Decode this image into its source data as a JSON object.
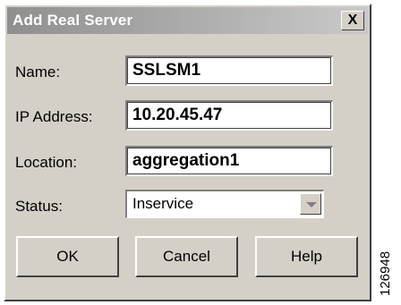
{
  "dialog": {
    "title": "Add Real Server",
    "close_symbol": "X"
  },
  "form": {
    "name_label": "Name:",
    "name_value": "SSLSM1",
    "ip_label": "IP Address:",
    "ip_value": "10.20.45.47",
    "location_label": "Location:",
    "location_value": "aggregation1",
    "status_label": "Status:",
    "status_value": "Inservice"
  },
  "buttons": {
    "ok": "OK",
    "cancel": "Cancel",
    "help": "Help"
  },
  "figure_id": "126948"
}
